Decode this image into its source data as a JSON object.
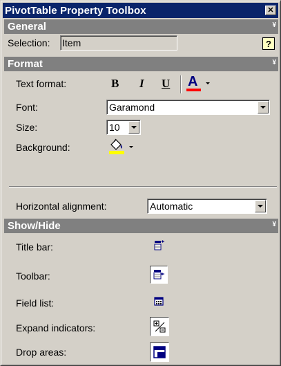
{
  "window": {
    "title": "PivotTable Property Toolbox",
    "close_glyph": "✕"
  },
  "general": {
    "header": "General",
    "collapse_glyph": "¥",
    "selection_label": "Selection:",
    "selection_value": "Item",
    "help_glyph": "?"
  },
  "format": {
    "header": "Format",
    "collapse_glyph": "¥",
    "text_format_label": "Text format:",
    "bold": "B",
    "italic": "I",
    "underline": "U",
    "font_color": "A",
    "font_color_swatch": "#ff0000",
    "font_label": "Font:",
    "font_value": "Garamond",
    "size_label": "Size:",
    "size_value": "10",
    "background_label": "Background:",
    "background_swatch": "#ffff00",
    "halign_label": "Horizontal alignment:",
    "halign_value": "Automatic"
  },
  "show_hide": {
    "header": "Show/Hide",
    "collapse_glyph": "¥",
    "items": [
      {
        "label": "Title bar:",
        "icon": "title-bar-icon",
        "pressed": false
      },
      {
        "label": "Toolbar:",
        "icon": "toolbar-icon",
        "pressed": true
      },
      {
        "label": "Field list:",
        "icon": "field-list-icon",
        "pressed": false
      },
      {
        "label": "Expand indicators:",
        "icon": "expand-indicators-icon",
        "pressed": true
      },
      {
        "label": "Drop areas:",
        "icon": "drop-areas-icon",
        "pressed": true
      }
    ]
  },
  "colors": {
    "titlebar": "#0a246a",
    "section_header": "#808080",
    "face": "#d4d0c8",
    "icon_blue": "#000080"
  }
}
